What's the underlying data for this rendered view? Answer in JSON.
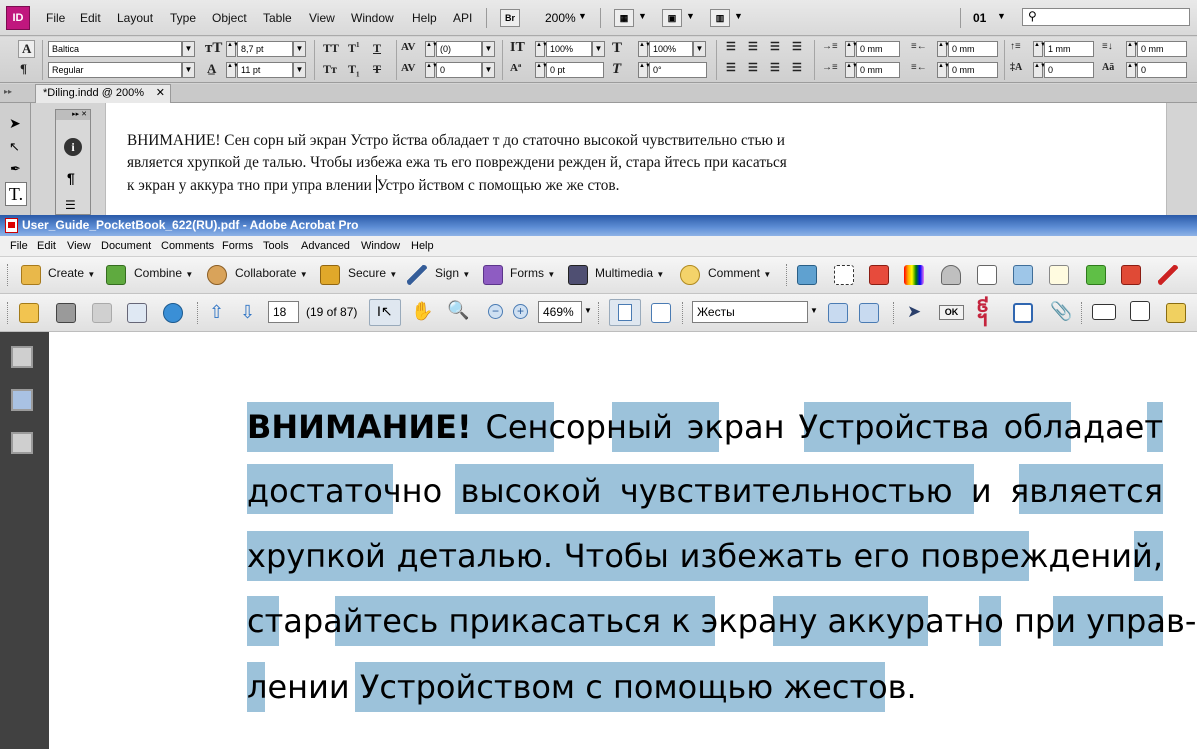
{
  "indesign": {
    "logo": "ID",
    "menu": [
      "File",
      "Edit",
      "Layout",
      "Type",
      "Object",
      "Table",
      "View",
      "Window",
      "Help",
      "API"
    ],
    "bridge_label": "Br",
    "zoom": "200%",
    "page_number": "01",
    "font_family": "Baltica",
    "font_style": "Regular",
    "font_size": "8,7 pt",
    "leading": "11 pt",
    "kerning": "(0)",
    "tracking": "0",
    "vertical_scale": "100%",
    "horizontal_scale": "100%",
    "baseline_shift": "0 pt",
    "skew": "0°",
    "indent_left": "0 mm",
    "indent_right": "0 mm",
    "space_before": "1 mm",
    "space_after": "0 mm",
    "first_line_indent": "0 mm",
    "last_line_indent": "0 mm",
    "drop_cap_lines": "0",
    "drop_cap_chars": "0",
    "doc_tab": "*Diling.indd @ 200%",
    "text_lines": [
      "ВНИМАНИЕ! Сен сорн ый экран Устро йства обладает т до статочно высокой чувствительно стью и",
      "является хрупкой де талью. Чтобы избежа ежа ть его повреждени режден й, стара йтесь при касаться",
      "к экран у аккура тно при упра влении ",
      "Устро йством с помощью же же стов."
    ]
  },
  "acrobat": {
    "title": "User_Guide_PocketBook_622(RU).pdf - Adobe Acrobat Pro",
    "menu": [
      "File",
      "Edit",
      "View",
      "Document",
      "Comments",
      "Forms",
      "Tools",
      "Advanced",
      "Window",
      "Help"
    ],
    "toolbar": {
      "create": "Create",
      "combine": "Combine",
      "collaborate": "Collaborate",
      "secure": "Secure",
      "sign": "Sign",
      "forms": "Forms",
      "multimedia": "Multimedia",
      "comment": "Comment"
    },
    "page_input": "18",
    "page_count": "(19 of 87)",
    "zoom": "469%",
    "find": "Жесты",
    "ok_label": "OK"
  },
  "pdf": {
    "bold": "ВНИМАНИЕ!",
    "line1_rest": " Сенсорный экран Устройства обладает",
    "line2": "достаточно высокой чувствительностью и  является",
    "line3": "хрупкой деталью. Чтобы избежать его повреждений,",
    "line4": "старайтесь прикасаться к экрану аккуратно при управ-",
    "line5": "лении Устройством с помощью жестов.",
    "highlight_color": "#9cc2da"
  }
}
